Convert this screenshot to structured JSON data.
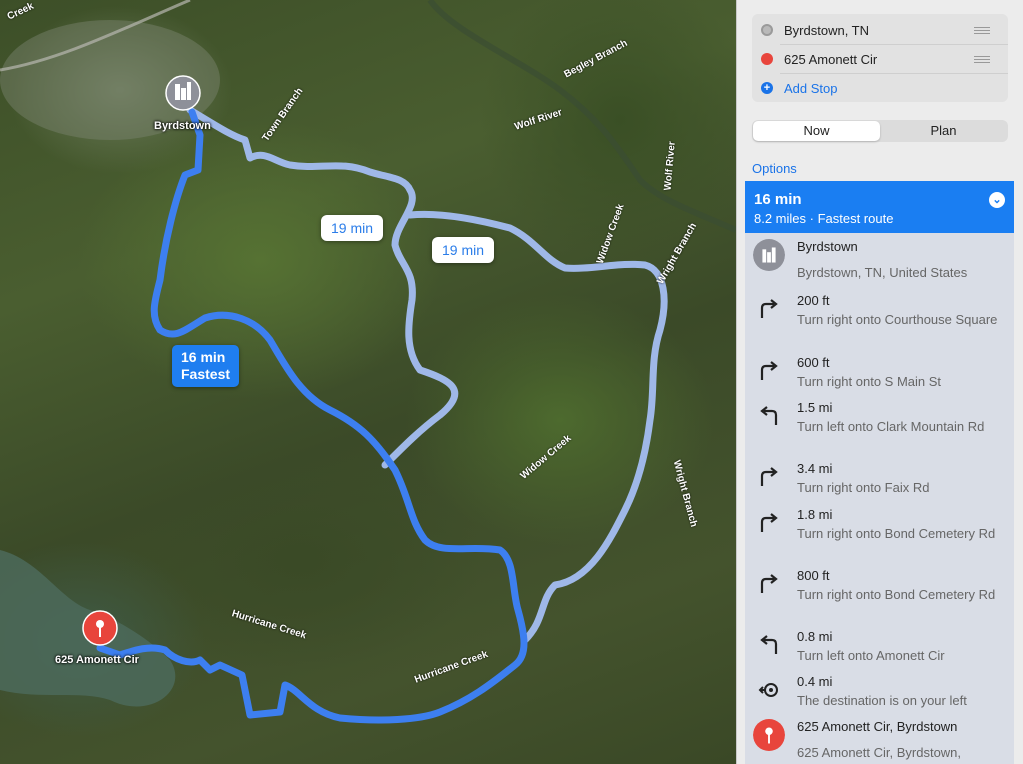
{
  "map": {
    "origin_label": "Byrdstown",
    "destination_label": "625 Amonett Cir",
    "callouts": {
      "alt1": "19 min",
      "alt2": "19 min",
      "fast_time": "16 min",
      "fast_tag": "Fastest"
    },
    "place_labels": {
      "town_branch": "Town Branch",
      "begley_branch": "Begley Branch",
      "wolf_river": "Wolf River",
      "wolf_river_2": "Wolf River",
      "widow_creek_n": "Widow Creek",
      "widow_creek_s": "Widow Creek",
      "wright_branch_n": "Wright Branch",
      "wright_branch_s": "Wright Branch",
      "hurricane_creek_w": "Hurricane Creek",
      "hurricane_creek_e": "Hurricane Creek",
      "creek_nw": "Creek"
    },
    "colors": {
      "fastest_route": "#3d7ff0",
      "alternate_route": "#9fb8e8",
      "destination_pin": "#e8453c",
      "origin_pin": "#8e9099"
    }
  },
  "panel": {
    "stops": {
      "origin": "Byrdstown, TN",
      "destination": "625 Amonett Cir",
      "add_stop": "Add Stop"
    },
    "mode": {
      "now": "Now",
      "plan": "Plan",
      "selected": "Now"
    },
    "options_label": "Options",
    "route": {
      "time": "16 min",
      "summary": "8.2 miles · Fastest route"
    },
    "steps": [
      {
        "icon": "city-icon",
        "distance": "Byrdstown",
        "text": "Byrdstown, TN, United States"
      },
      {
        "icon": "turn-right-icon",
        "distance": "200 ft",
        "text": "Turn right onto Courthouse Square"
      },
      {
        "icon": "turn-right-icon",
        "distance": "600 ft",
        "text": "Turn right onto S Main St"
      },
      {
        "icon": "turn-left-icon",
        "distance": "1.5 mi",
        "text": "Turn left onto Clark Mountain Rd"
      },
      {
        "icon": "turn-right-icon",
        "distance": "3.4 mi",
        "text": "Turn right onto Faix Rd"
      },
      {
        "icon": "turn-right-icon",
        "distance": "1.8 mi",
        "text": "Turn right onto Bond Cemetery Rd"
      },
      {
        "icon": "turn-right-icon",
        "distance": "800 ft",
        "text": "Turn right onto Bond Cemetery Rd"
      },
      {
        "icon": "turn-left-icon",
        "distance": "0.8 mi",
        "text": "Turn left onto Amonett Cir"
      },
      {
        "icon": "arrive-left-icon",
        "distance": "0.4 mi",
        "text": "The destination is on your left"
      },
      {
        "icon": "destination-pin-icon",
        "distance": "625 Amonett Cir, Byrdstown",
        "text": "625 Amonett Cir, Byrdstown,"
      }
    ]
  }
}
